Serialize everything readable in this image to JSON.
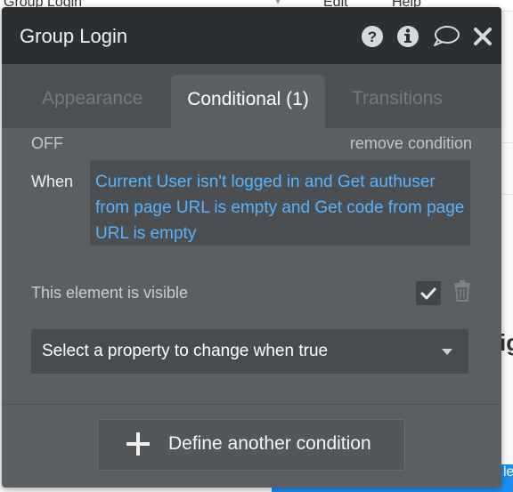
{
  "background": {
    "menu": [
      "Group Login",
      "Edit",
      "Help"
    ],
    "peek_text": "ig",
    "blue_text": "le"
  },
  "panel": {
    "title": "Group Login",
    "icons": {
      "help": "question-circle-icon",
      "info": "info-circle-icon",
      "comment": "speech-bubble-icon",
      "close": "close-icon"
    },
    "tabs": [
      {
        "label": "Appearance",
        "active": false
      },
      {
        "label": "Conditional (1)",
        "active": true
      },
      {
        "label": "Transitions",
        "active": false
      }
    ],
    "condition": {
      "status": "OFF",
      "remove_label": "remove condition",
      "when_label": "When",
      "expression": "Current User isn't logged in and Get authuser from page URL is empty and Get code from page URL is empty"
    },
    "visibility": {
      "label": "This element is visible",
      "checked": true
    },
    "property_select": {
      "value": "Select a property to change when true"
    },
    "define_button": {
      "label": "Define another condition"
    }
  },
  "colors": {
    "panel_bg": "#5c5f61",
    "header_bg": "#2b2f31",
    "expression_text": "#58b2ff",
    "accent_blue": "#1d8ef0"
  }
}
